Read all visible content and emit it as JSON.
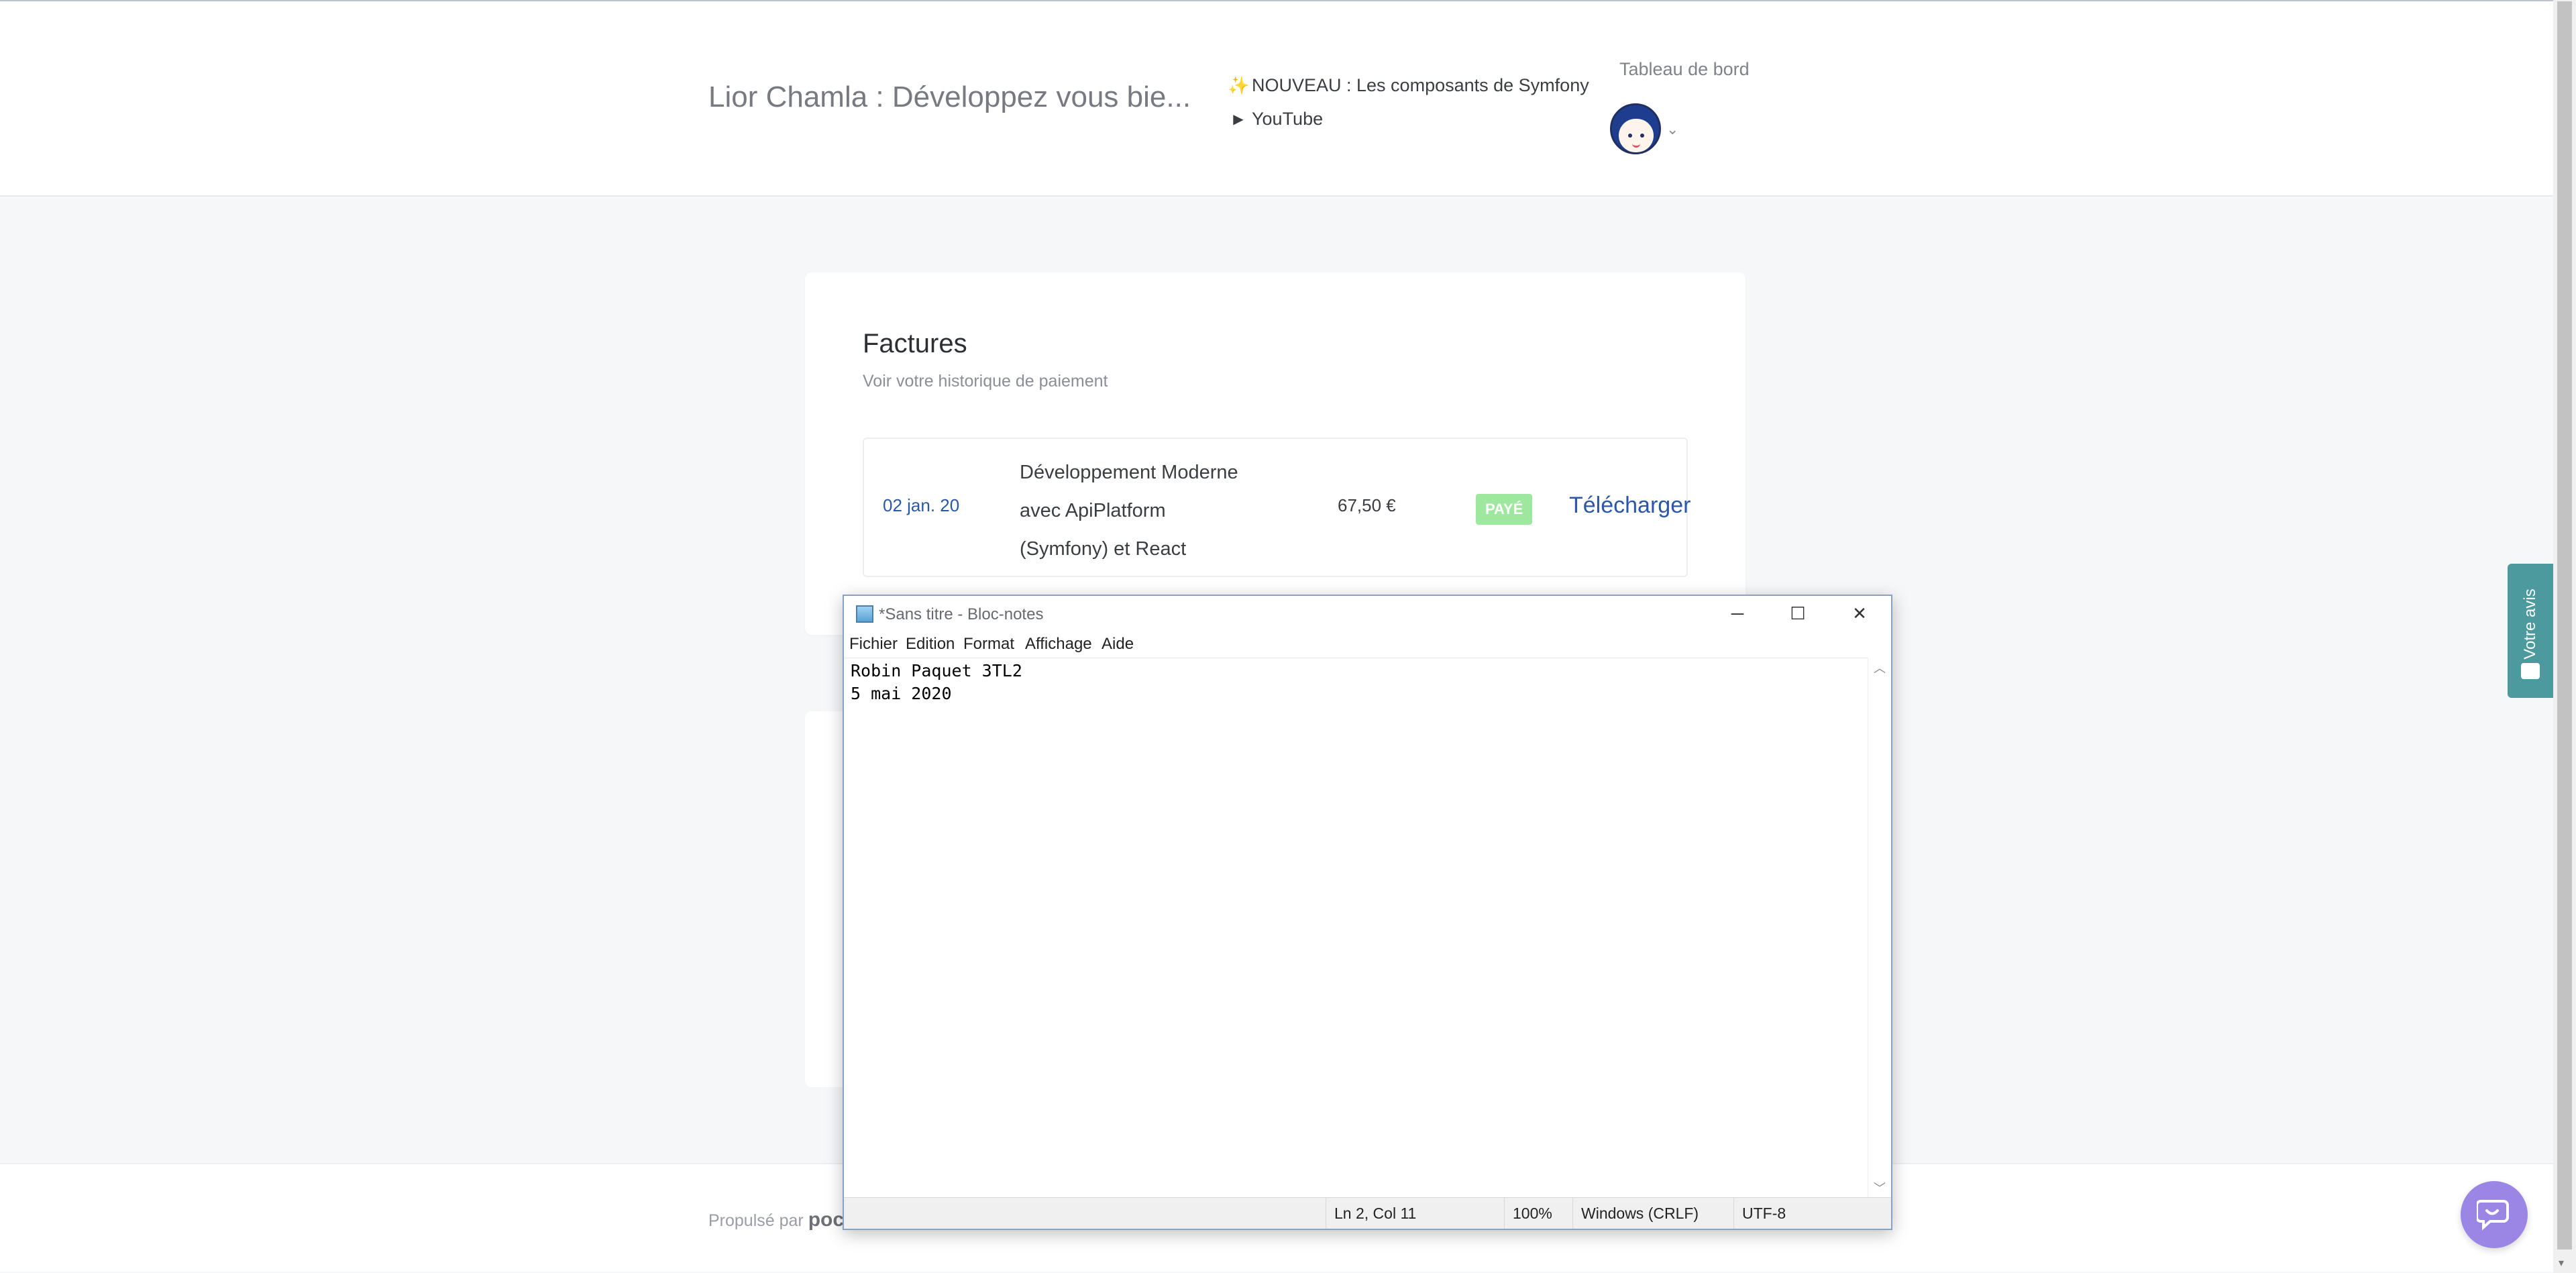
{
  "header": {
    "site_title": "Lior Chamla : Développez vous bie...",
    "nav": [
      {
        "icon": "sparkle-icon",
        "label": "NOUVEAU : Les composants de Symfony"
      },
      {
        "icon": "play-icon",
        "label": "YouTube"
      }
    ],
    "dashboard_label": "Tableau de bord"
  },
  "invoices": {
    "title": "Factures",
    "subtitle": "Voir votre historique de paiement",
    "rows": [
      {
        "date": "02 jan. 20",
        "title_lines": [
          "Développement Moderne",
          "avec ApiPlatform",
          "(Symfony) et React"
        ],
        "amount": "67,50 €",
        "status": "PAYÉ",
        "action": "Télécharger"
      }
    ],
    "status_color": "#9ee79e",
    "link_color": "#2b57a6"
  },
  "footer": {
    "prefix": "Propulsé par",
    "brand": "poc"
  },
  "feedback": {
    "label": "Votre avis",
    "color": "#4c9a9e"
  },
  "chat": {
    "icon": "chat-icon",
    "color": "#9b86e6"
  },
  "notepad": {
    "title": "*Sans titre - Bloc-notes",
    "menus": [
      "Fichier",
      "Edition",
      "Format",
      "Affichage",
      "Aide"
    ],
    "lines": [
      "Robin Paquet 3TL2",
      "5 mai 2020"
    ],
    "status": {
      "position": "Ln 2, Col 11",
      "zoom": "100%",
      "line_endings": "Windows (CRLF)",
      "encoding": "UTF-8"
    }
  }
}
